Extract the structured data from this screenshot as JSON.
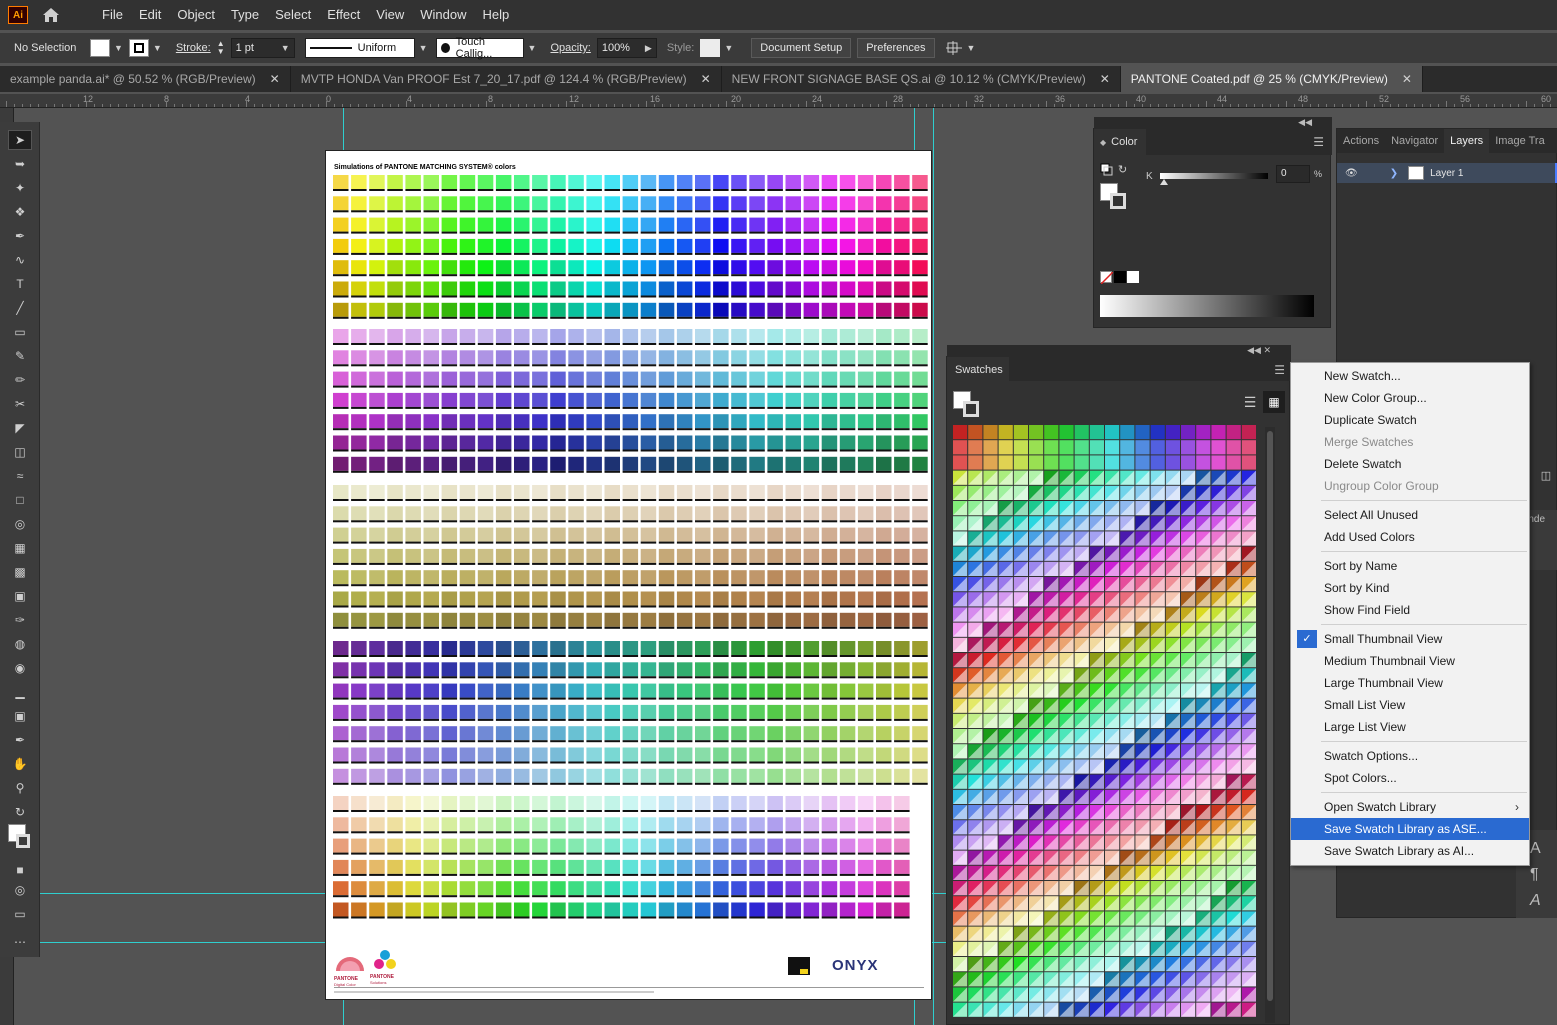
{
  "app": {
    "logo": "Ai"
  },
  "menu": [
    "File",
    "Edit",
    "Object",
    "Type",
    "Select",
    "Effect",
    "View",
    "Window",
    "Help"
  ],
  "control_bar": {
    "selection": "No Selection",
    "stroke_label": "Stroke:",
    "stroke_weight": "1 pt",
    "stroke_profile": "Uniform",
    "brush": "Touch Callig...",
    "opacity_label": "Opacity:",
    "opacity": "100%",
    "style_label": "Style:",
    "document_setup": "Document Setup",
    "preferences": "Preferences"
  },
  "tabs": [
    {
      "title": "example panda.ai* @ 50.52 % (RGB/Preview)",
      "active": false
    },
    {
      "title": "MVTP  HONDA Van PROOF Est  7_20_17.pdf @ 124.4 % (RGB/Preview)",
      "active": false
    },
    {
      "title": "NEW FRONT SIGNAGE BASE QS.ai @ 10.12 % (CMYK/Preview)",
      "active": false
    },
    {
      "title": "PANTONE Coated.pdf @ 25 % (CMYK/Preview)",
      "active": true
    }
  ],
  "ruler": [
    "12",
    "8",
    "4",
    "0",
    "4",
    "8",
    "12",
    "16",
    "20",
    "24",
    "28",
    "32",
    "36",
    "40",
    "44",
    "48",
    "52",
    "56",
    "60"
  ],
  "artboard": {
    "title": "Simulations of PANTONE MATCHING SYSTEM® colors",
    "logo_text": "ONYX",
    "pantone_label_1": "PANTONE",
    "pantone_label_2": "Digital Color",
    "pantone_label_3": "PANTONE",
    "pantone_label_4": "Solutions"
  },
  "color_panel": {
    "title": "Color",
    "channel": "K",
    "value": "0",
    "unit": "%"
  },
  "swatches_panel": {
    "title": "Swatches"
  },
  "layers_panel": {
    "tabs": [
      "Actions",
      "Navigator",
      "Layers",
      "Image Tra"
    ],
    "active_tab": "Layers",
    "layer_name": "Layer 1"
  },
  "context_menu": {
    "items": [
      {
        "label": "New Swatch...",
        "state": "normal"
      },
      {
        "label": "New Color Group...",
        "state": "normal"
      },
      {
        "label": "Duplicate Swatch",
        "state": "normal"
      },
      {
        "label": "Merge Swatches",
        "state": "disabled"
      },
      {
        "label": "Delete Swatch",
        "state": "normal"
      },
      {
        "label": "Ungroup Color Group",
        "state": "disabled"
      },
      {
        "label": "Select All Unused",
        "state": "normal"
      },
      {
        "label": "Add Used Colors",
        "state": "normal"
      },
      {
        "label": "Sort by Name",
        "state": "normal"
      },
      {
        "label": "Sort by Kind",
        "state": "normal"
      },
      {
        "label": "Show Find Field",
        "state": "normal"
      },
      {
        "label": "Small Thumbnail View",
        "state": "checked"
      },
      {
        "label": "Medium Thumbnail View",
        "state": "normal"
      },
      {
        "label": "Large Thumbnail View",
        "state": "normal"
      },
      {
        "label": "Small List View",
        "state": "normal"
      },
      {
        "label": "Large List View",
        "state": "normal"
      },
      {
        "label": "Swatch Options...",
        "state": "normal"
      },
      {
        "label": "Spot Colors...",
        "state": "normal"
      },
      {
        "label": "Open Swatch Library",
        "state": "submenu"
      },
      {
        "label": "Save Swatch Library as ASE...",
        "state": "highlighted"
      },
      {
        "label": "Save Swatch Library as AI...",
        "state": "normal"
      }
    ]
  },
  "colors": {
    "accent": "#2a6ad1",
    "guide": "#2fcfcf",
    "brand": "#ff9a00"
  }
}
